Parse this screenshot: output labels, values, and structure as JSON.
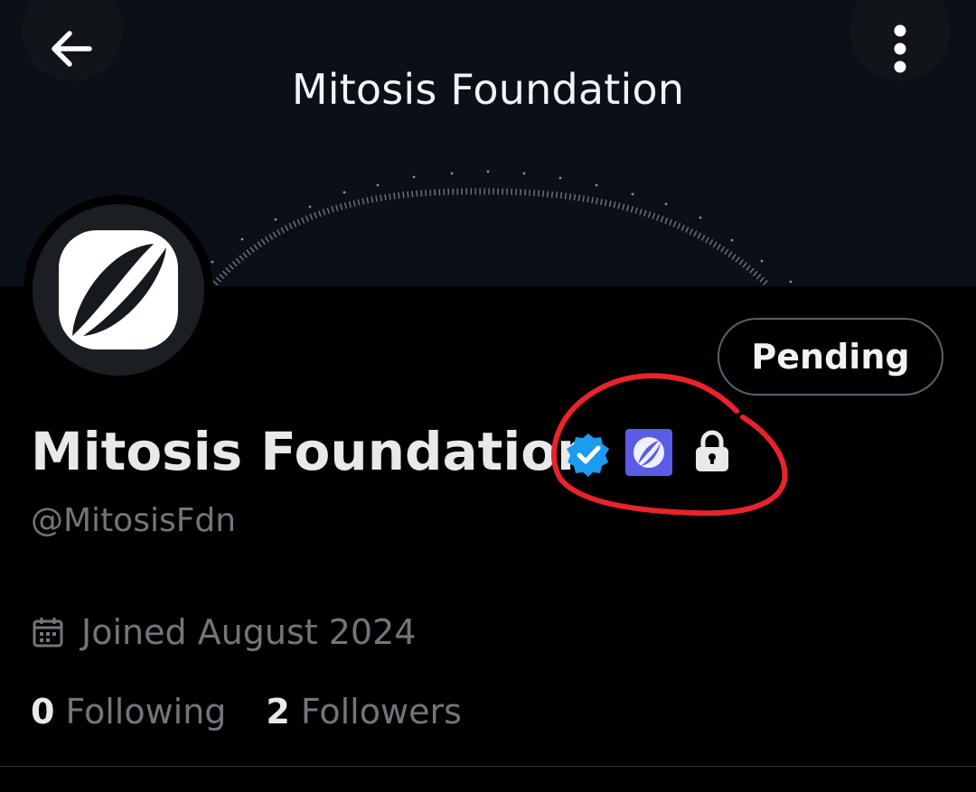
{
  "header": {
    "title": "Mitosis Foundation",
    "back_icon": "arrow-left-icon",
    "more_icon": "more-vertical-icon"
  },
  "profile": {
    "display_name": "Mitosis Foundation",
    "handle": "@MitosisFdn",
    "avatar_icon": "mitosis-logo-icon",
    "badges": [
      "verified-badge-icon",
      "affiliate-badge-icon",
      "lock-icon"
    ],
    "joined": "Joined August 2024",
    "calendar_icon": "calendar-icon"
  },
  "actions": {
    "pending_label": "Pending"
  },
  "stats": [
    {
      "count": "0",
      "label": "Following"
    },
    {
      "count": "2",
      "label": "Followers"
    }
  ],
  "colors": {
    "verified": "#1d9bf0",
    "affiliate_badge": "#5b5ce6",
    "annotation": "#e8232b",
    "secondary_text": "#71767b"
  }
}
